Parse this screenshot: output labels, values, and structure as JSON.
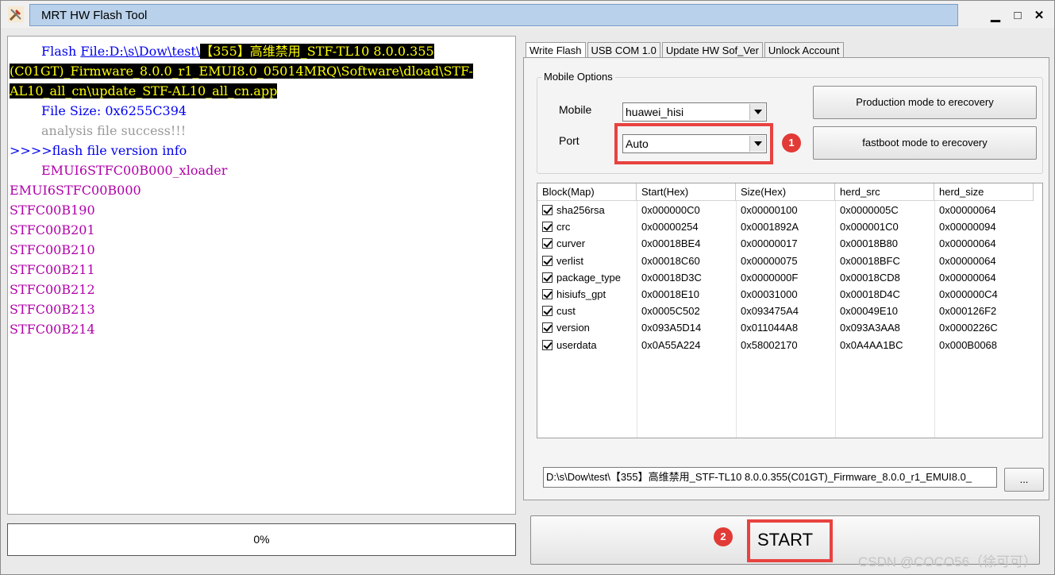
{
  "window": {
    "title": "MRT HW Flash Tool",
    "minimize_glyph": "▁",
    "maximize_glyph": "□",
    "close_glyph": "✕",
    "icon": "tools-icon"
  },
  "log": {
    "flash_prefix": "Flash ",
    "flash_path": "File:D:\\s\\Dow\\test\\",
    "flash_highlight_1": "【355】高维禁用_STF-TL10 8.0.0.355",
    "flash_highlight_2": "(C01GT)_Firmware_8.0.0_r1_EMUI8.0_05014MRQ\\Software\\dload\\STF-",
    "flash_highlight_3": "AL10_all_cn\\update_STF-AL10_all_cn.app",
    "file_size": "File Size: 0x6255C394",
    "analysis": "analysis file success!!!",
    "version_header": ">>>>flash file version info",
    "versions": [
      "EMUI6STFC00B000_xloader",
      "EMUI6STFC00B000",
      "STFC00B190",
      "STFC00B201",
      "STFC00B210",
      "STFC00B211",
      "STFC00B212",
      "STFC00B213",
      "STFC00B214"
    ]
  },
  "progress": {
    "text": "0%",
    "value": 0
  },
  "tabs": [
    {
      "label": "Write Flash",
      "active": true
    },
    {
      "label": "USB COM 1.0",
      "active": false
    },
    {
      "label": "Update HW Sof_Ver",
      "active": false
    },
    {
      "label": "Unlock Account",
      "active": false
    }
  ],
  "mobile_options": {
    "group_label": "Mobile Options",
    "mobile_label": "Mobile",
    "mobile_value": "huawei_hisi",
    "port_label": "Port",
    "port_value": "Auto",
    "production_button": "Production mode to erecovery",
    "fastboot_button": "fastboot mode to erecovery"
  },
  "annotations": {
    "badge_1": "1",
    "badge_2": "2",
    "color": "#e8423f"
  },
  "table": {
    "headers": [
      "Block(Map)",
      "Start(Hex)",
      "Size(Hex)",
      "herd_src",
      "herd_size"
    ],
    "rows": [
      {
        "name": "sha256rsa",
        "start": "0x000000C0",
        "size": "0x00000100",
        "src": "0x0000005C",
        "hsize": "0x00000064",
        "checked": true
      },
      {
        "name": "crc",
        "start": "0x00000254",
        "size": "0x0001892A",
        "src": "0x000001C0",
        "hsize": "0x00000094",
        "checked": true
      },
      {
        "name": "curver",
        "start": "0x00018BE4",
        "size": "0x00000017",
        "src": "0x00018B80",
        "hsize": "0x00000064",
        "checked": true
      },
      {
        "name": "verlist",
        "start": "0x00018C60",
        "size": "0x00000075",
        "src": "0x00018BFC",
        "hsize": "0x00000064",
        "checked": true
      },
      {
        "name": "package_type",
        "start": "0x00018D3C",
        "size": "0x0000000F",
        "src": "0x00018CD8",
        "hsize": "0x00000064",
        "checked": true
      },
      {
        "name": "hisiufs_gpt",
        "start": "0x00018E10",
        "size": "0x00031000",
        "src": "0x00018D4C",
        "hsize": "0x000000C4",
        "checked": true
      },
      {
        "name": "cust",
        "start": "0x0005C502",
        "size": "0x093475A4",
        "src": "0x00049E10",
        "hsize": "0x000126F2",
        "checked": true
      },
      {
        "name": "version",
        "start": "0x093A5D14",
        "size": "0x011044A8",
        "src": "0x093A3AA8",
        "hsize": "0x0000226C",
        "checked": true
      },
      {
        "name": "userdata",
        "start": "0x0A55A224",
        "size": "0x58002170",
        "src": "0x0A4AA1BC",
        "hsize": "0x000B0068",
        "checked": true
      }
    ]
  },
  "file_path": "D:\\s\\Dow\\test\\【355】高维禁用_STF-TL10 8.0.0.355(C01GT)_Firmware_8.0.0_r1_EMUI8.0_",
  "browse_label": "...",
  "start_label": "START",
  "watermark": "CSDN @COCO56（徐可可）"
}
